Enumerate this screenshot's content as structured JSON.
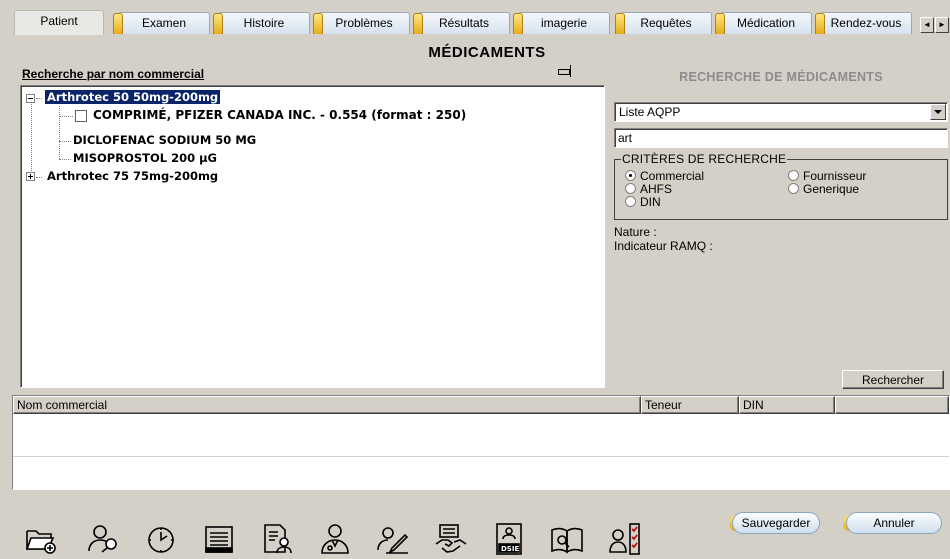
{
  "tabs": [
    {
      "label": "Patient",
      "active": true
    },
    {
      "label": "Examen",
      "active": false
    },
    {
      "label": "Histoire",
      "active": false
    },
    {
      "label": "Problèmes",
      "active": false
    },
    {
      "label": "Résultats",
      "active": false
    },
    {
      "label": "imagerie",
      "active": false
    },
    {
      "label": "Requêtes",
      "active": false
    },
    {
      "label": "Médication",
      "active": false
    },
    {
      "label": "Rendez-vous",
      "active": false
    }
  ],
  "tab_scroll": {
    "left": "◄",
    "right": "►"
  },
  "page_title": "MÉDICAMENTS",
  "search_by_label": "Recherche par nom commercial",
  "tree": {
    "node1": "Arthrotec 50 50mg-200mg",
    "node1_child1": "COMPRIMÉ, PFIZER CANADA INC. - 0.554 (format : 250)",
    "node1_child2": "DICLOFENAC SODIUM 50 MG",
    "node1_child3": "MISOPROSTOL 200 µG",
    "node2": "Arthrotec 75 75mg-200mg"
  },
  "right_panel": {
    "title": "RECHERCHE DE MÉDICAMENTS",
    "list_selected": "Liste AQPP",
    "search_value": "art",
    "criteria_title": "CRITÈRES DE RECHERCHE",
    "criteria": {
      "commercial": "Commercial",
      "ahfs": "AHFS",
      "din": "DIN",
      "fournisseur": "Fournisseur",
      "generique": "Generique",
      "selected": "Commercial"
    },
    "nature_label": "Nature :",
    "ramq_label": "Indicateur RAMQ :",
    "search_button": "Rechercher"
  },
  "result_columns": [
    "Nom commercial",
    "Teneur",
    "DIN"
  ],
  "buttons": {
    "save": "Sauvegarder",
    "cancel": "Annuler"
  },
  "toolbar_icons": [
    "folder-add-icon",
    "user-search-icon",
    "clock-icon",
    "list-icon",
    "document-user-icon",
    "doctor-icon",
    "user-pen-icon",
    "handshake-icon",
    "dsie-card-icon",
    "book-icon",
    "user-checklist-icon"
  ],
  "toolbar_text": {
    "dsie": "DSIE"
  }
}
